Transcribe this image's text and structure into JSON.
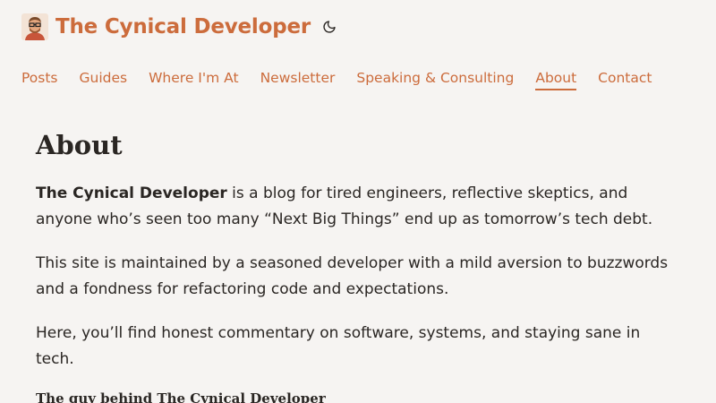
{
  "site": {
    "title": "The Cynical Developer",
    "logo_icon": "developer-avatar-icon",
    "theme_toggle_icon": "moon-icon",
    "accent_color": "#cc6c3c",
    "background_color": "#f6f4f2"
  },
  "nav": {
    "items": [
      {
        "label": "Posts",
        "active": false
      },
      {
        "label": "Guides",
        "active": false
      },
      {
        "label": "Where I'm At",
        "active": false
      },
      {
        "label": "Newsletter",
        "active": false
      },
      {
        "label": "Speaking & Consulting",
        "active": false
      },
      {
        "label": "About",
        "active": true
      },
      {
        "label": "Contact",
        "active": false
      }
    ]
  },
  "page": {
    "heading": "About",
    "intro_strong": "The Cynical Developer",
    "intro_rest": " is a blog for tired engineers, reflective skeptics, and anyone who’s seen too many “Next Big Things” end up as tomorrow’s tech debt.",
    "paragraph2": "This site is maintained by a seasoned developer with a mild aversion to buzzwords and a fondness for refactoring code and expectations.",
    "paragraph3": "Here, you’ll find honest commentary on software, systems, and staying sane in tech.",
    "subheading": "The guy behind The Cynical Developer"
  }
}
